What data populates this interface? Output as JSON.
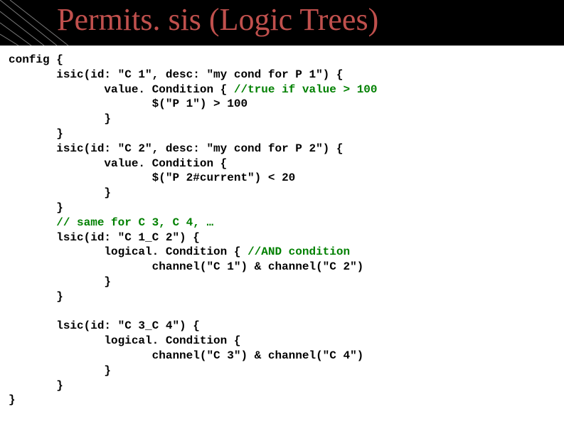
{
  "title": "Permits. sis (Logic Trees)",
  "code": {
    "l1": "config {",
    "l2": "       isic(id: \"C 1\", desc: \"my cond for P 1\") {",
    "l3": "              value. Condition { ",
    "c3": "//true if value > 100",
    "l4": "                     $(\"P 1\") > 100",
    "l5": "              }",
    "l6": "       }",
    "l7": "       isic(id: \"C 2\", desc: \"my cond for P 2\") {",
    "l8": "              value. Condition {",
    "l9": "                     $(\"P 2#current\") < 20",
    "l10": "              }",
    "l11": "       }",
    "l12a": "       ",
    "c12": "// same for C 3, C 4, …",
    "l13": "       lsic(id: \"C 1_C 2\") {",
    "l14": "              logical. Condition { ",
    "c14": "//AND condition",
    "l15": "                     channel(\"C 1\") & channel(\"C 2\")",
    "l16": "              }",
    "l17": "       }",
    "l18": "",
    "l19": "       lsic(id: \"C 3_C 4\") {",
    "l20": "              logical. Condition {",
    "l21": "                     channel(\"C 3\") & channel(\"C 4\")",
    "l22": "              }",
    "l23": "       }",
    "l24": "}"
  }
}
